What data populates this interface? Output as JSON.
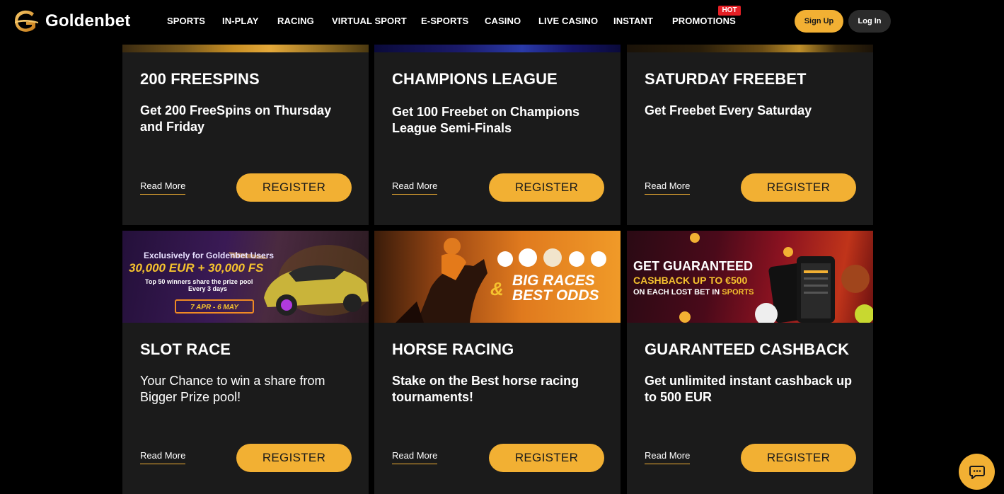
{
  "header": {
    "logo_text": "Goldenbet",
    "nav": [
      "SPORTS",
      "IN-PLAY",
      "RACING",
      "VIRTUAL SPORT",
      "E-SPORTS",
      "CASINO",
      "LIVE CASINO",
      "INSTANT",
      "PROMOTIONS"
    ],
    "hot_badge": "HOT",
    "signup_label": "Sign Up",
    "login_label": "Log In"
  },
  "promotions": [
    {
      "title": "200 FREESPINS",
      "description": "Get 200 FreeSpins on Thursday and Friday",
      "read_more": "Read More",
      "register": "REGISTER"
    },
    {
      "title": "CHAMPIONS LEAGUE",
      "description": "Get 100 Freebet on Champions League Semi-Finals",
      "read_more": "Read More",
      "register": "REGISTER"
    },
    {
      "title": "SATURDAY FREEBET",
      "description": "Get Freebet Every Saturday",
      "read_more": "Read More",
      "register": "REGISTER"
    },
    {
      "title": "SLOT RACE",
      "description": "Your Chance to win a share from Bigger Prize pool!",
      "read_more": "Read More",
      "register": "REGISTER",
      "banner": {
        "line1": "Exclusively for Goldenbet Users",
        "line2": "30,000 EUR + 30,000 FS",
        "line3": "Top 50 winners share the prize pool",
        "line4": "Every 3 days",
        "dates": "7 APR - 6 MAY"
      }
    },
    {
      "title": "HORSE RACING",
      "description": "Stake on the Best horse racing tournaments!",
      "read_more": "Read More",
      "register": "REGISTER",
      "banner": {
        "amp": "&",
        "line1": "BIG RACES",
        "line2": "BEST ODDS"
      }
    },
    {
      "title": "GUARANTEED CASHBACK",
      "description": "Get unlimited instant cashback up to 500 EUR",
      "read_more": "Read More",
      "register": "REGISTER",
      "banner": {
        "line1": "GET GUARANTEED",
        "line2": "CASHBACK UP TO €500",
        "line3_prefix": "ON EACH LOST BET IN ",
        "line3_highlight": "SPORTS"
      }
    }
  ],
  "colors": {
    "accent": "#f2b033",
    "background": "#000000",
    "card": "#1b1b1b",
    "hot": "#e41f25"
  }
}
